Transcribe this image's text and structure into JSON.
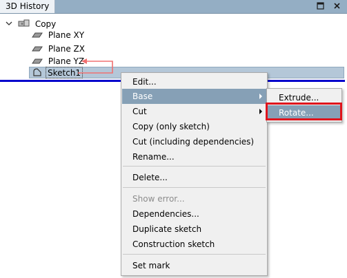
{
  "window": {
    "title": "3D History"
  },
  "tree": {
    "root": {
      "label": "Copy"
    },
    "items": [
      {
        "label": "Plane XY"
      },
      {
        "label": "Plane ZX"
      },
      {
        "label": "Plane YZ"
      },
      {
        "label": "Sketch1"
      }
    ]
  },
  "context_menu": {
    "items": [
      {
        "label": "Edit..."
      },
      {
        "label": "Base"
      },
      {
        "label": "Cut"
      },
      {
        "label": "Copy (only sketch)"
      },
      {
        "label": "Cut (including dependencies)"
      },
      {
        "label": "Rename..."
      },
      {
        "label": "Delete..."
      },
      {
        "label": "Show error..."
      },
      {
        "label": "Dependencies..."
      },
      {
        "label": "Duplicate sketch"
      },
      {
        "label": "Construction sketch"
      },
      {
        "label": "Set mark"
      }
    ],
    "submenu": {
      "items": [
        {
          "label": "Extrude..."
        },
        {
          "label": "Rotate..."
        }
      ]
    }
  },
  "colors": {
    "titlebar": "#94aec4",
    "selection": "#b4c7d8",
    "menu_highlight": "#86a0b6",
    "annotation_red": "#e0141c",
    "drop_line_blue": "#0000cc"
  }
}
